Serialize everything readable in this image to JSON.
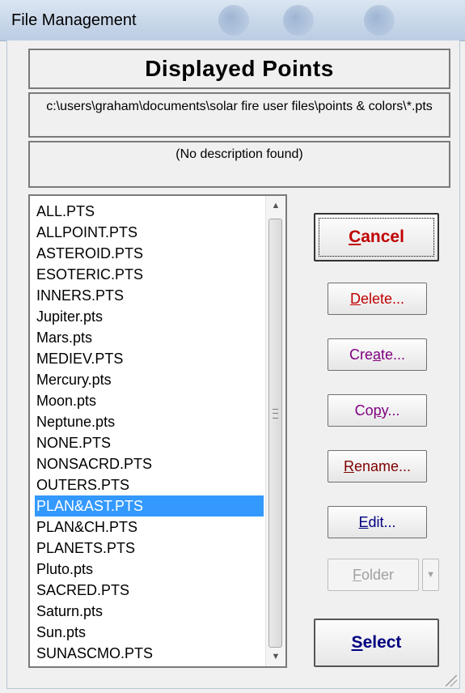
{
  "window": {
    "title": "File Management"
  },
  "heading": "Displayed Points",
  "path": "c:\\users\\graham\\documents\\solar fire user files\\points & colors\\*.pts",
  "description": "(No description found)",
  "files": [
    "ALL.PTS",
    "ALLPOINT.PTS",
    "ASTEROID.PTS",
    "ESOTERIC.PTS",
    "INNERS.PTS",
    "Jupiter.pts",
    "Mars.pts",
    "MEDIEV.PTS",
    "Mercury.pts",
    "Moon.pts",
    "Neptune.pts",
    "NONE.PTS",
    "NONSACRD.PTS",
    "OUTERS.PTS",
    "PLAN&AST.PTS",
    "PLAN&CH.PTS",
    "PLANETS.PTS",
    "Pluto.pts",
    "SACRED.PTS",
    "Saturn.pts",
    "Sun.pts",
    "SUNASCMO.PTS"
  ],
  "selected_file": "PLAN&AST.PTS",
  "buttons": {
    "cancel": "Cancel",
    "delete": "Delete...",
    "create": "Create...",
    "copy": "Copy...",
    "rename": "Rename...",
    "edit": "Edit...",
    "folder": "Folder",
    "select": "Select"
  },
  "icons": {
    "scroll_up": "triangle-up",
    "scroll_down": "triangle-down",
    "folder_dropdown": "triangle-down"
  },
  "colors": {
    "selection": "#3399ff",
    "cancel_text": "#c00000",
    "select_text": "#000080"
  }
}
